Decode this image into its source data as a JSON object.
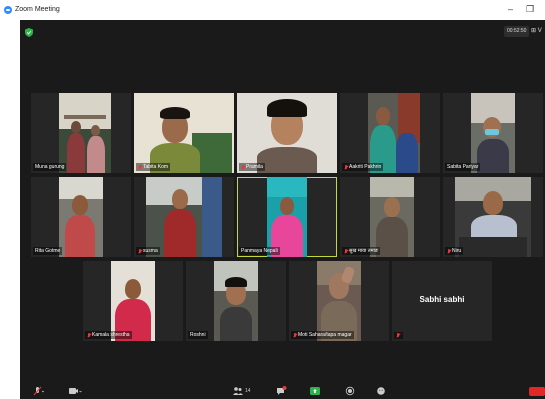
{
  "window": {
    "title": "Zoom Meeting",
    "minimize": "–",
    "restore": "❐"
  },
  "meeting": {
    "timer": "00:52:50",
    "view": "⊞ V"
  },
  "participants": [
    {
      "name": "Muna gurung",
      "muted": false
    },
    {
      "name": "Tabita Kom",
      "muted": true
    },
    {
      "name": "Pramila",
      "muted": true
    },
    {
      "name": "Aakriti Pakhrin",
      "muted": true
    },
    {
      "name": "Sabita Pariyar",
      "muted": false
    },
    {
      "name": "Rita Gotme",
      "muted": false
    },
    {
      "name": "susma",
      "muted": true
    },
    {
      "name": "Panmaya Nepali",
      "muted": false
    },
    {
      "name": "सुख माया तमाङ",
      "muted": true
    },
    {
      "name": "Niru",
      "muted": true
    },
    {
      "name": "Kamala shrestha",
      "muted": true
    },
    {
      "name": "Roshni",
      "muted": false
    },
    {
      "name": "Moti Sahara/tapa magar",
      "muted": true
    },
    {
      "name": "",
      "muted": true,
      "display_text": "Sabhi sabhi"
    }
  ],
  "toolbar": {
    "participants_count": "14",
    "chat_badge": "1"
  },
  "colors": {
    "active_speaker_border": "#c4d83a",
    "muted_red": "#e23b3b",
    "end_button": "#e02828"
  }
}
